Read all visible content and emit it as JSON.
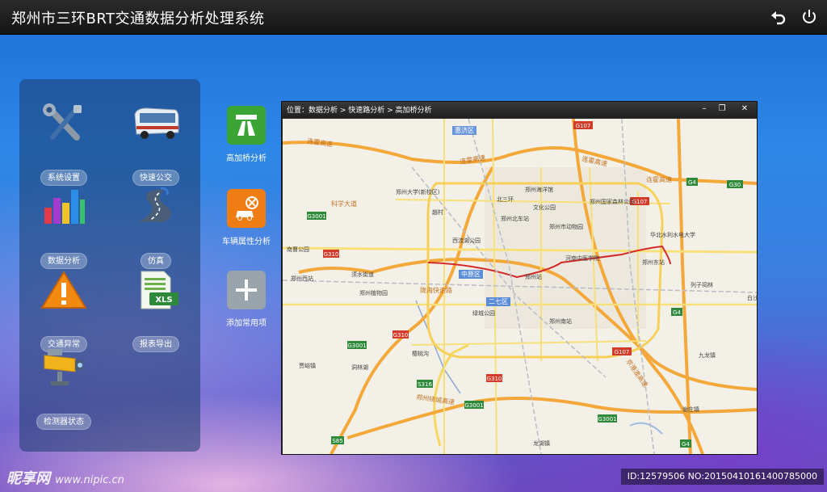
{
  "header": {
    "title": "郑州市三环BRT交通数据分析处理系统",
    "icons": [
      "back-icon",
      "power-icon"
    ]
  },
  "sidebar": {
    "items": [
      {
        "label": "系统设置",
        "icon": "tools-icon"
      },
      {
        "label": "快速公交",
        "icon": "bus-icon"
      },
      {
        "label": "数据分析",
        "icon": "bar-chart-icon"
      },
      {
        "label": "仿真",
        "icon": "road-icon"
      },
      {
        "label": "交通异常",
        "icon": "warning-icon"
      },
      {
        "label": "报表导出",
        "icon": "xls-icon"
      },
      {
        "label": "检测器状态",
        "icon": "camera-icon"
      }
    ]
  },
  "shortcuts": {
    "items": [
      {
        "label": "高加桥分析",
        "icon": "highway-icon",
        "color": "#3aa535"
      },
      {
        "label": "车辆属性分析",
        "icon": "car-tools-icon",
        "color": "#f07d14"
      },
      {
        "label": "添加常用项",
        "icon": "plus-icon",
        "color": "#9aa4ad"
      }
    ]
  },
  "map_window": {
    "breadcrumb": "位置：数据分析 > 快速路分析 > 高加桥分析",
    "controls": [
      "minimize-icon",
      "restore-icon",
      "close-icon"
    ],
    "labels": {
      "huiji": "惠济区",
      "liancuo1": "连霍高速",
      "liancuo2": "连霍高速",
      "liancuo3": "连霍高速",
      "liancuo4": "连霍高速",
      "g107": "G107",
      "g107b": "G107",
      "g107c": "G107",
      "g4": "G4",
      "g4b": "G4",
      "g4c": "G4",
      "g30": "G30",
      "g3001": "G3001",
      "g3001b": "G3001",
      "g3001c": "G3001",
      "g3001d": "G3001",
      "g310": "G310",
      "g310b": "G310",
      "g310c": "G310",
      "s316": "S316",
      "s85": "S85",
      "kexue": "科学大道",
      "zzdx": "郑州大学(新校区)",
      "zhaocun": "趙村",
      "beisanhuan": "北三环",
      "haiyangguan": "郑州海洋馆",
      "wenhua": "文化公园",
      "guojia": "郑州国家森林公园",
      "beizhan": "郑州北车站",
      "dongwuyuan": "郑州市动物园",
      "huabei": "华北水利水电大学",
      "xiliu": "西流湖公园",
      "henan": "河南中医学院",
      "dongzhan": "郑州东站",
      "xuyuan": "须水街道",
      "zhiwuyuan": "郑州植物园",
      "longhai": "陇海快速路",
      "zhongyuan": "中原区",
      "zhengzhouzhan": "郑州站",
      "liezi": "列子祠林",
      "erqi": "二七区",
      "lvcheng": "绿城公园",
      "nanzhan": "郑州南站",
      "baisha": "白沙",
      "xixi": "郑州西站",
      "xiangyun": "南曹公园",
      "jiulong": "九龙镇",
      "houzhai": "谢庄镇",
      "jiazhen": "贾峪镇",
      "donghu": "洞林湖",
      "shejie": "樱桃沟",
      "jingcheng": "郑州绕城高速",
      "jingguang": "京港澳高速",
      "longhu": "龙湖镇"
    }
  },
  "watermark": {
    "logo": "昵享网",
    "url": "www.nipic.cn",
    "id_text": "ID:12579506 NO:20150410161400785000"
  }
}
